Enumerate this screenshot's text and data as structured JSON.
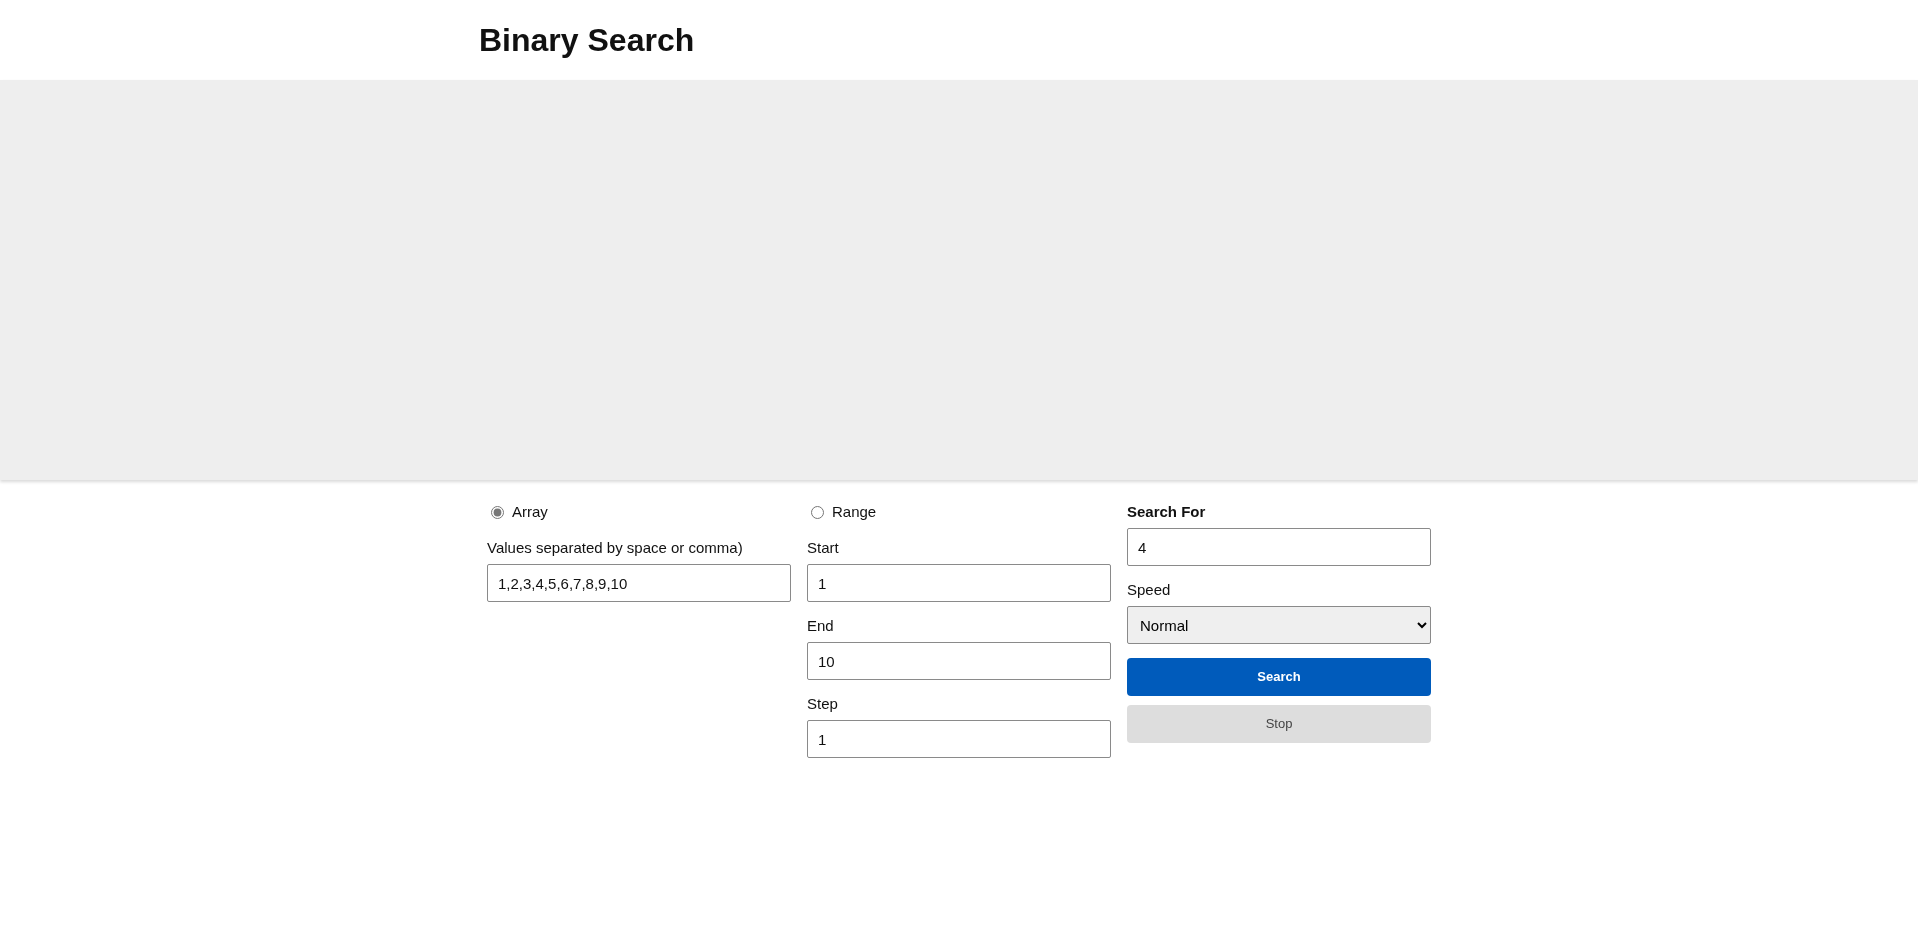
{
  "title": "Binary Search",
  "modes": [
    {
      "label": "Array",
      "selected": true
    },
    {
      "label": "Range",
      "selected": false
    }
  ],
  "array_field": {
    "label": "Values separated by space or comma)",
    "value": "1,2,3,4,5,6,7,8,9,10"
  },
  "range_fields": [
    {
      "label": "Start",
      "value": "1"
    },
    {
      "label": "End",
      "value": "10"
    },
    {
      "label": "Step",
      "value": "1"
    }
  ],
  "search_for": {
    "label": "Search For",
    "value": "4"
  },
  "speed": {
    "label": "Speed",
    "value": "Normal"
  },
  "buttons": [
    {
      "label": "Search",
      "kind": "primary"
    },
    {
      "label": "Stop",
      "kind": "secondary"
    }
  ]
}
